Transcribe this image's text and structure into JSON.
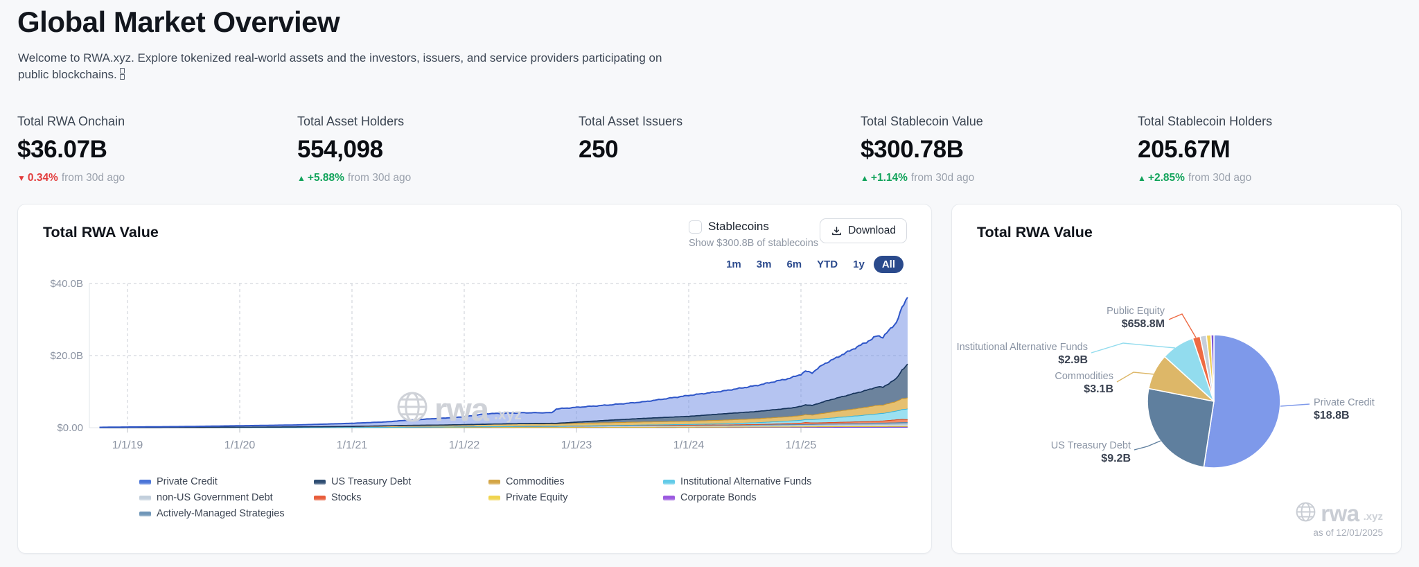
{
  "page": {
    "title": "Global Market Overview",
    "subtitle_line1": "Welcome to RWA.xyz. Explore tokenized real-world assets and the investors, issuers, and service providers participating on",
    "subtitle_line2": "public blockchains.",
    "subtitle_icon": "chain-link"
  },
  "stats": [
    {
      "label": "Total RWA Onchain",
      "value": "$36.07B",
      "delta_arrow": "▼",
      "delta": "0.34%",
      "delta_suffix": "from 30d ago",
      "delta_color": "#e23d3d"
    },
    {
      "label": "Total Asset Holders",
      "value": "554,098",
      "delta_arrow": "▲",
      "delta": "+5.88%",
      "delta_suffix": "from 30d ago",
      "delta_color": "#12a35b"
    },
    {
      "label": "Total Asset Issuers",
      "value": "250"
    },
    {
      "label": "Total Stablecoin Value",
      "value": "$300.78B",
      "delta_arrow": "▲",
      "delta": "+1.14%",
      "delta_suffix": "from 30d ago",
      "delta_color": "#12a35b"
    },
    {
      "label": "Total Stablecoin Holders",
      "value": "205.67M",
      "delta_arrow": "▲",
      "delta": "+2.85%",
      "delta_suffix": "from 30d ago",
      "delta_color": "#12a35b"
    }
  ],
  "area_card": {
    "title": "Total RWA Value",
    "stablecoins_label": "Stablecoins",
    "stablecoins_sub": "Show $300.8B of stablecoins",
    "download_label": "Download",
    "download_icon": "download-icon",
    "ranges": [
      "1m",
      "3m",
      "6m",
      "YTD",
      "1y",
      "All"
    ],
    "selected_range": "All",
    "watermark": "rwa",
    "watermark_suffix": ".xyz",
    "chart_data": {
      "type": "area",
      "stacked": true,
      "ylim": [
        0,
        41.6
      ],
      "grid": "dashed",
      "y_ticks": [
        {
          "y": 0,
          "label": "$0.00"
        },
        {
          "y": 20,
          "label": "$20.0B"
        },
        {
          "y": 40,
          "label": "$40.0B"
        }
      ],
      "x_ticks": [
        {
          "x": 2019,
          "label": "1/1/19"
        },
        {
          "x": 2020,
          "label": "1/1/20"
        },
        {
          "x": 2021,
          "label": "1/1/21"
        },
        {
          "x": 2022,
          "label": "1/1/22"
        },
        {
          "x": 2023,
          "label": "1/1/23"
        },
        {
          "x": 2024,
          "label": "1/1/24"
        },
        {
          "x": 2025,
          "label": "1/1/25"
        }
      ],
      "x": [
        2018.75,
        2019.0,
        2019.5,
        2020.0,
        2020.5,
        2021.0,
        2021.3,
        2021.5,
        2021.8,
        2022.0,
        2022.2,
        2022.5,
        2022.78,
        2022.82,
        2023.0,
        2023.3,
        2023.6,
        2024.0,
        2024.3,
        2024.6,
        2024.9,
        2025.0,
        2025.04,
        2025.1,
        2025.2,
        2025.3,
        2025.45,
        2025.6,
        2025.68,
        2025.73,
        2025.85,
        2025.9,
        2025.95
      ],
      "unit": "$B",
      "series": [
        {
          "name": "Corporate Bonds",
          "stroke": "#6d3fd4",
          "fill": "rgba(150,104,230,0.9)",
          "values": [
            0,
            0,
            0,
            0,
            0,
            0.01,
            0.01,
            0.01,
            0.02,
            0.02,
            0.02,
            0.03,
            0.03,
            0.03,
            0.04,
            0.05,
            0.06,
            0.07,
            0.08,
            0.09,
            0.1,
            0.1,
            0.11,
            0.11,
            0.12,
            0.12,
            0.13,
            0.13,
            0.14,
            0.14,
            0.15,
            0.15,
            0.15
          ]
        },
        {
          "name": "Private Equity",
          "stroke": "#d8b52e",
          "fill": "rgba(242,216,92,0.9)",
          "values": [
            0,
            0,
            0,
            0,
            0,
            0.01,
            0.01,
            0.02,
            0.02,
            0.02,
            0.03,
            0.03,
            0.03,
            0.03,
            0.04,
            0.05,
            0.06,
            0.07,
            0.08,
            0.1,
            0.12,
            0.13,
            0.14,
            0.14,
            0.15,
            0.16,
            0.17,
            0.18,
            0.19,
            0.19,
            0.2,
            0.2,
            0.2
          ]
        },
        {
          "name": "non-US Government Debt",
          "stroke": "#aebfce",
          "fill": "rgba(207,218,228,0.95)",
          "values": [
            0,
            0,
            0,
            0.01,
            0.02,
            0.04,
            0.06,
            0.1,
            0.14,
            0.17,
            0.2,
            0.25,
            0.28,
            0.28,
            0.3,
            0.34,
            0.38,
            0.4,
            0.4,
            0.4,
            0.42,
            0.42,
            0.42,
            0.42,
            0.45,
            0.45,
            0.48,
            0.5,
            0.53,
            0.53,
            0.57,
            0.6,
            0.6
          ]
        },
        {
          "name": "Actively-Managed Strategies",
          "stroke": "#5d87a8",
          "fill": "rgba(136,169,196,0.95)",
          "values": [
            0,
            0,
            0,
            0,
            0,
            0,
            0,
            0,
            0,
            0,
            0,
            0,
            0.01,
            0.01,
            0.02,
            0.04,
            0.06,
            0.09,
            0.12,
            0.16,
            0.2,
            0.22,
            0.24,
            0.24,
            0.28,
            0.3,
            0.34,
            0.38,
            0.4,
            0.4,
            0.45,
            0.48,
            0.5
          ]
        },
        {
          "name": "Stocks",
          "stroke": "#d94f26",
          "fill": "rgba(240,123,84,0.9)",
          "values": [
            0,
            0,
            0,
            0,
            0,
            0,
            0,
            0,
            0,
            0.01,
            0.02,
            0.02,
            0.02,
            0.02,
            0.03,
            0.04,
            0.05,
            0.06,
            0.08,
            0.12,
            0.3,
            0.38,
            0.52,
            0.42,
            0.38,
            0.42,
            0.46,
            0.52,
            0.56,
            0.6,
            0.82,
            0.85,
            0.8
          ]
        },
        {
          "name": "Institutional Alternative Funds",
          "stroke": "#3fb5d8",
          "fill": "rgba(144,221,240,0.9)",
          "values": [
            0,
            0,
            0,
            0,
            0,
            0,
            0,
            0,
            0,
            0,
            0,
            0,
            0,
            0,
            0.02,
            0.06,
            0.12,
            0.2,
            0.32,
            0.5,
            0.72,
            0.8,
            0.85,
            0.9,
            1.1,
            1.3,
            1.55,
            1.85,
            2.0,
            2.1,
            2.4,
            2.75,
            2.9
          ]
        },
        {
          "name": "Commodities",
          "stroke": "#c8952f",
          "fill": "rgba(227,185,97,0.9)",
          "values": [
            0.02,
            0.03,
            0.06,
            0.12,
            0.18,
            0.3,
            0.42,
            0.5,
            0.55,
            0.6,
            0.68,
            0.72,
            0.68,
            0.68,
            0.74,
            0.8,
            0.85,
            0.9,
            1.0,
            1.1,
            1.2,
            1.3,
            1.33,
            1.28,
            1.5,
            1.7,
            1.95,
            2.2,
            2.4,
            2.3,
            2.7,
            3.0,
            3.1
          ]
        },
        {
          "name": "US Treasury Debt",
          "stroke": "#16345c",
          "fill": "rgba(66,96,130,0.78)",
          "values": [
            0,
            0,
            0,
            0,
            0,
            0,
            0,
            0,
            0,
            0.01,
            0.02,
            0.08,
            0.15,
            0.15,
            0.35,
            0.7,
            1.0,
            1.35,
            1.75,
            2.0,
            2.35,
            2.55,
            2.75,
            2.65,
            3.2,
            3.6,
            4.2,
            4.75,
            5.1,
            4.95,
            6.3,
            8.0,
            9.2
          ]
        },
        {
          "name": "Private Credit",
          "stroke": "#2f56c8",
          "fill": "rgba(108,137,228,0.5)",
          "values": [
            0.08,
            0.15,
            0.25,
            0.4,
            0.55,
            0.85,
            1.1,
            1.45,
            1.9,
            2.2,
            2.9,
            3.0,
            2.95,
            4.0,
            4.1,
            4.25,
            4.6,
            5.8,
            6.3,
            7.2,
            8.3,
            8.9,
            9.3,
            9.1,
            10.4,
            11.1,
            12.3,
            13.5,
            14.2,
            13.9,
            15.6,
            17.2,
            18.8
          ]
        }
      ],
      "legend_columns": [
        [
          {
            "label": "Private Credit",
            "color": "#4a74d8"
          },
          {
            "label": "non-US Government Debt",
            "color": "#c2cfdc"
          },
          {
            "label": "Actively-Managed Strategies",
            "color": "#6f96b8"
          }
        ],
        [
          {
            "label": "US Treasury Debt",
            "color": "#2e4d72"
          },
          {
            "label": "Stocks",
            "color": "#e85c3a"
          }
        ],
        [
          {
            "label": "Commodities",
            "color": "#d3a545"
          },
          {
            "label": "Private Equity",
            "color": "#f0d44e"
          }
        ],
        [
          {
            "label": "Institutional Alternative Funds",
            "color": "#62cbe8"
          },
          {
            "label": "Corporate Bonds",
            "color": "#9b59e0"
          }
        ]
      ]
    }
  },
  "pie_card": {
    "title": "Total RWA Value",
    "as_of": "as of 12/01/2025",
    "watermark": "rwa",
    "watermark_suffix": ".xyz",
    "chart_data": {
      "type": "pie",
      "unit": "$B",
      "slices": [
        {
          "name": "Private Credit",
          "value": 18.8,
          "label": "$18.8B",
          "color": "#7e99ea",
          "labeled": true
        },
        {
          "name": "US Treasury Debt",
          "value": 9.2,
          "label": "$9.2B",
          "color": "#5f7f9e",
          "labeled": true
        },
        {
          "name": "Commodities",
          "value": 3.1,
          "label": "$3.1B",
          "color": "#ddb768",
          "labeled": true
        },
        {
          "name": "Institutional Alternative Funds",
          "value": 2.9,
          "label": "$2.9B",
          "color": "#92dcee",
          "labeled": true
        },
        {
          "name": "Public Equity",
          "value": 0.6588,
          "label": "$658.8M",
          "color": "#ee6a43",
          "labeled": true
        },
        {
          "name": "non-US Government Debt",
          "value": 0.55,
          "color": "#c7cfda"
        },
        {
          "name": "Private Equity",
          "value": 0.4,
          "color": "#f0cf5a"
        },
        {
          "name": "Corporate Bonds",
          "value": 0.25,
          "color": "#7a52d4"
        }
      ]
    }
  }
}
